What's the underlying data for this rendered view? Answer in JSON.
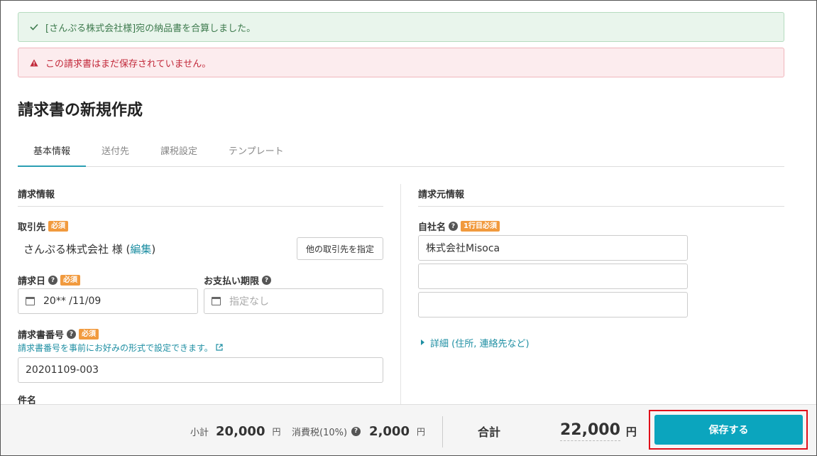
{
  "alerts": {
    "success": "[さんぷる株式会社様]宛の納品書を合算しました。",
    "error": "この請求書はまだ保存されていません。"
  },
  "page_title": "請求書の新規作成",
  "tabs": [
    {
      "label": "基本情報",
      "active": true
    },
    {
      "label": "送付先",
      "active": false
    },
    {
      "label": "課税設定",
      "active": false
    },
    {
      "label": "テンプレート",
      "active": false
    }
  ],
  "billing_info": {
    "heading": "請求情報",
    "client_label": "取引先",
    "required": "必須",
    "client_name": "さんぷる株式会社 様 (",
    "client_edit": "編集",
    "client_close": ")",
    "other_client_button": "他の取引先を指定",
    "invoice_date_label": "請求日",
    "invoice_date_value": "20** /11/09",
    "due_date_label": "お支払い期限",
    "due_date_placeholder": "指定なし",
    "invoice_number_label": "請求書番号",
    "invoice_number_hint": "請求書番号を事前にお好みの形式で設定できます。",
    "invoice_number_value": "20201109-003",
    "subject_label": "件名"
  },
  "issuer_info": {
    "heading": "請求元情報",
    "company_label": "自社名",
    "first_line_required": "1行目必須",
    "company_line1": "株式会社Misoca",
    "company_line2": "",
    "company_line3": "",
    "details_link": "詳細 (住所, 連絡先など)"
  },
  "footer": {
    "subtotal_label": "小計",
    "subtotal_value": "20,000",
    "tax_label": "消費税(10%)",
    "tax_value": "2,000",
    "yen": "円",
    "total_label": "合計",
    "total_value": "22,000",
    "save_button": "保存する"
  },
  "colors": {
    "accent": "#0ba5be",
    "required_badge": "#f19a3e",
    "success_bg": "#e9f5ec",
    "error_bg": "#fcecee"
  }
}
